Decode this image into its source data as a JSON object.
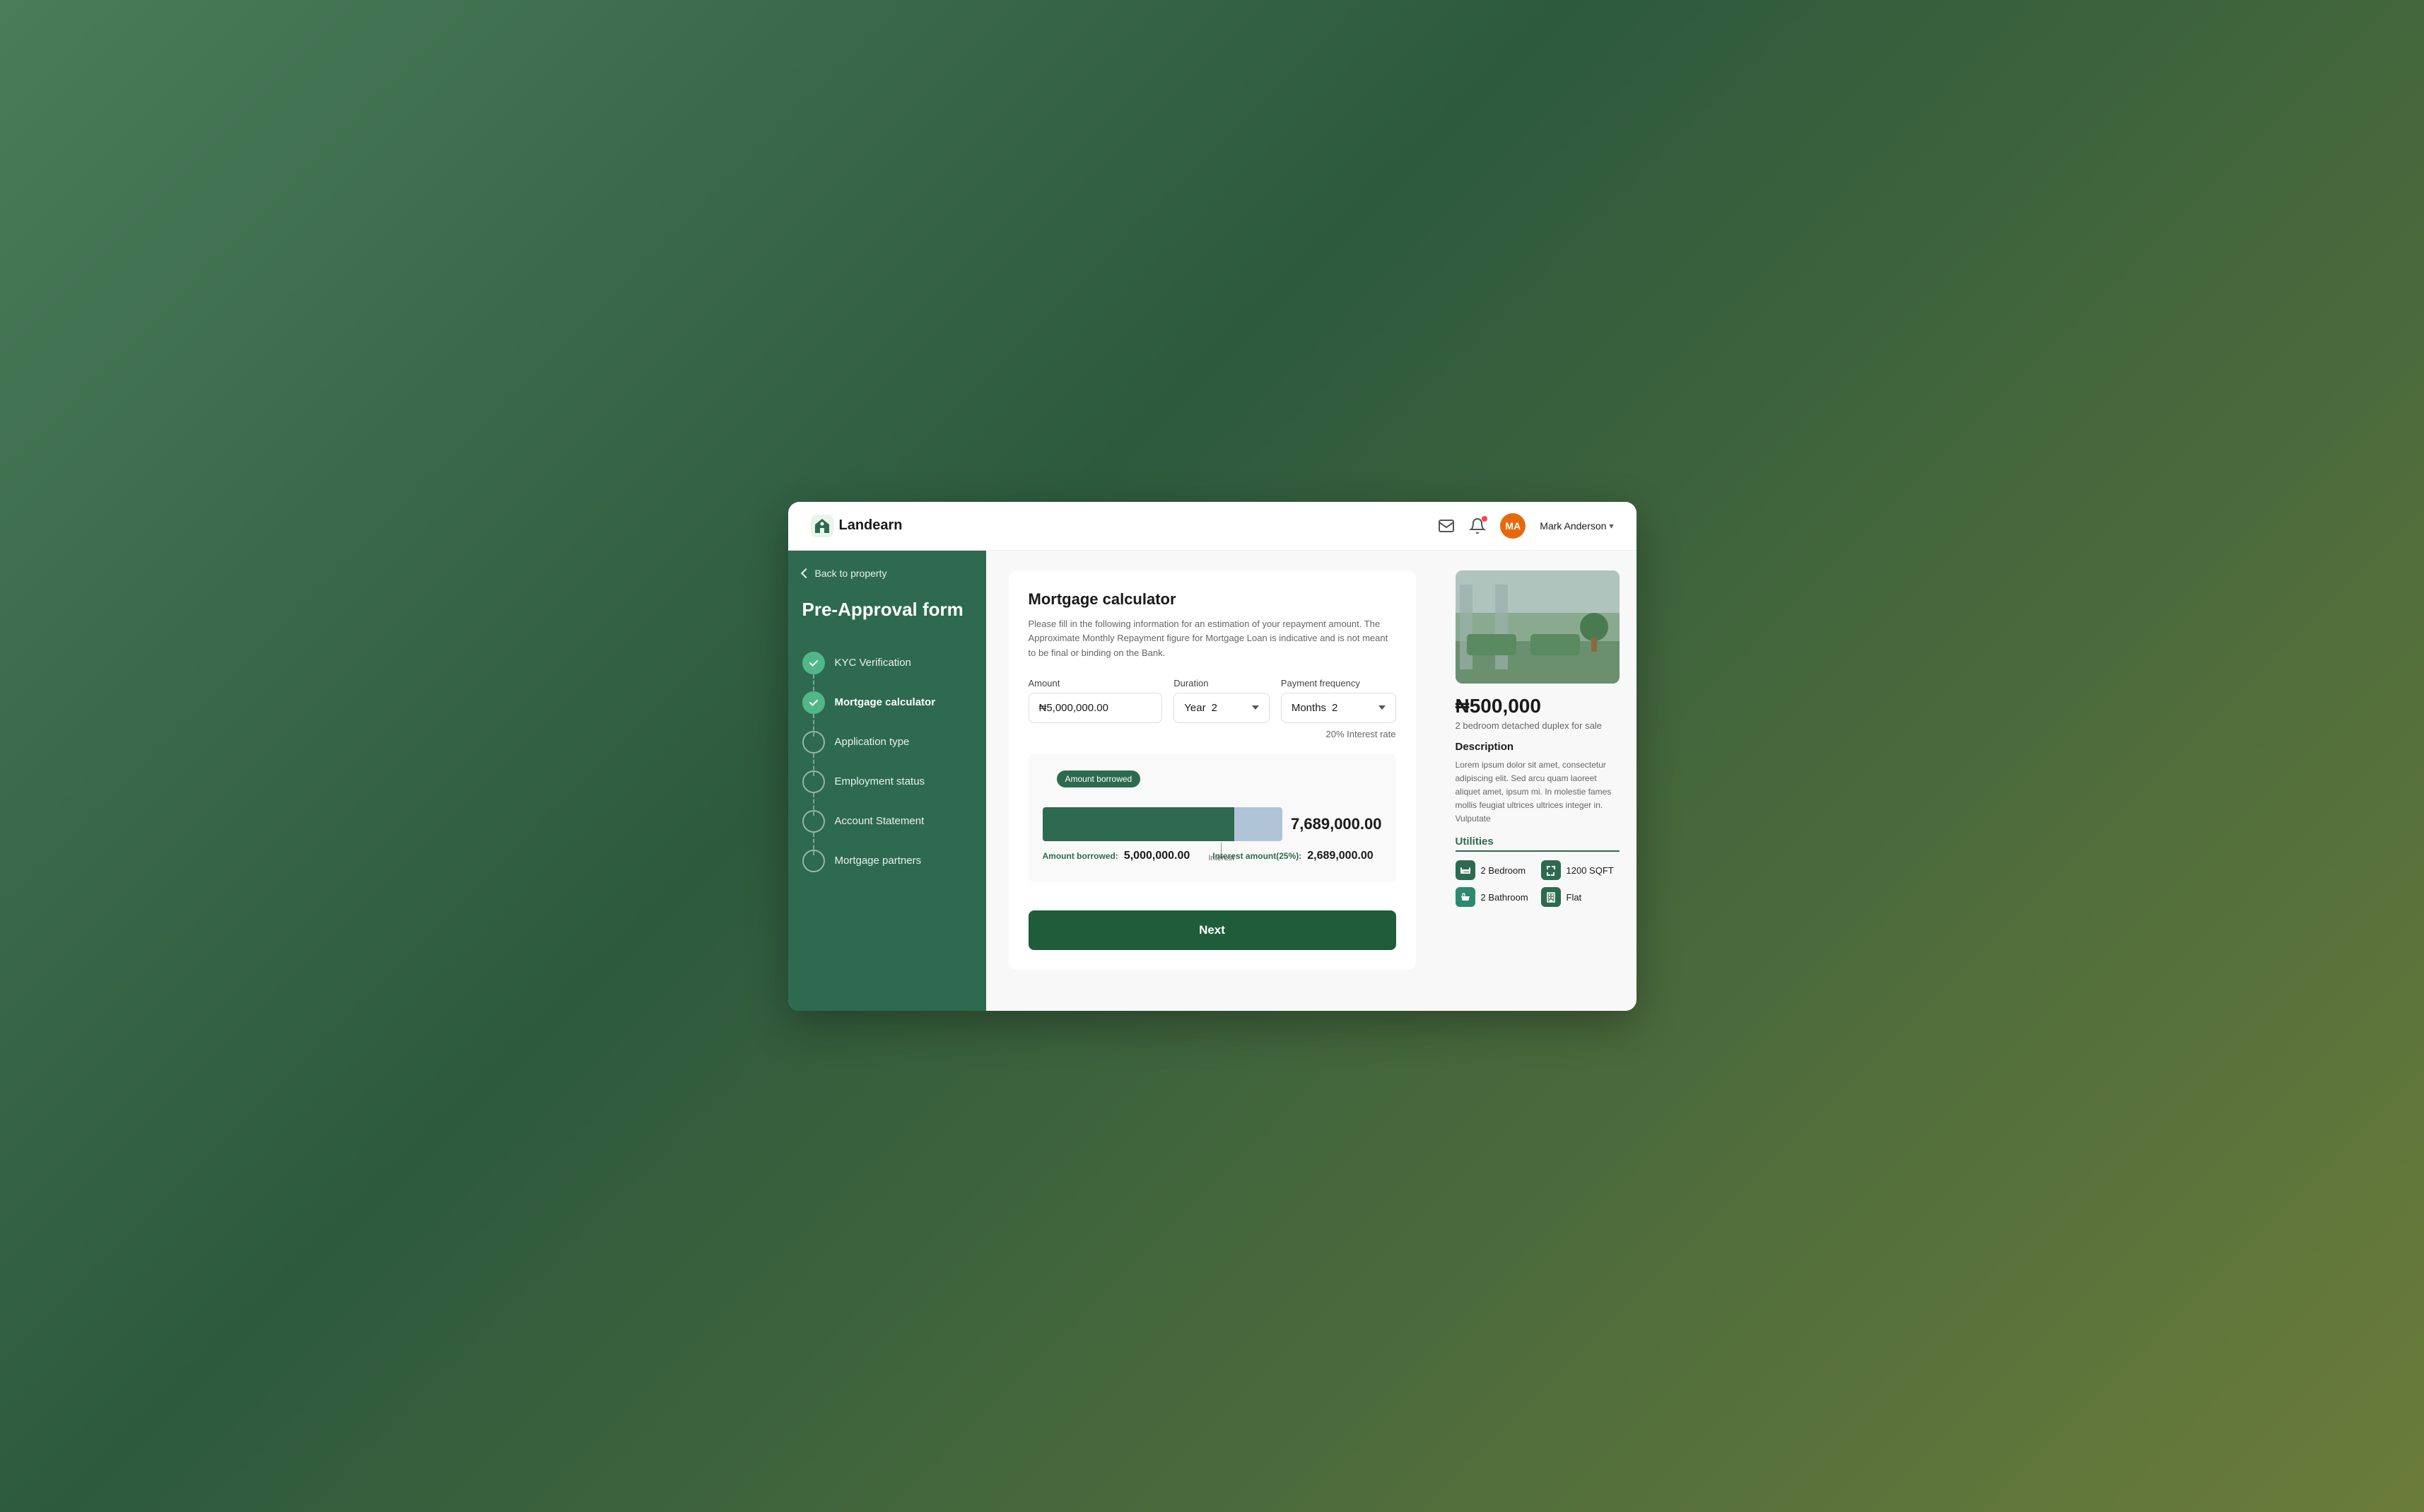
{
  "header": {
    "logo_text": "Landearn",
    "user_initials": "MA",
    "user_name": "Mark Anderson",
    "user_chevron": "▾"
  },
  "sidebar": {
    "back_label": "Back to property",
    "form_title": "Pre-Approval form",
    "steps": [
      {
        "id": "kyc",
        "label": "KYC Verification",
        "state": "completed"
      },
      {
        "id": "mortgage",
        "label": "Mortgage calculator",
        "state": "active"
      },
      {
        "id": "application",
        "label": "Application type",
        "state": "inactive"
      },
      {
        "id": "employment",
        "label": "Employment status",
        "state": "inactive"
      },
      {
        "id": "account",
        "label": "Account Statement",
        "state": "inactive"
      },
      {
        "id": "partners",
        "label": "Mortgage partners",
        "state": "inactive"
      }
    ]
  },
  "calculator": {
    "title": "Mortgage calculator",
    "description": "Please fill in the following information for an estimation of your repayment amount. The Approximate Monthly Repayment figure for Mortgage Loan is indicative and is not meant to be final or binding on the Bank.",
    "amount_label": "Amount",
    "amount_value": "₦5,000,000.00",
    "duration_label": "Duration",
    "duration_unit": "Year",
    "duration_value": "2",
    "frequency_label": "Payment frequency",
    "frequency_unit": "Months",
    "frequency_value": "2",
    "interest_rate_text": "20% Interest rate",
    "chart_tooltip": "Amount borrowed",
    "chart_total": "7,689,000.00",
    "interest_marker": "Interest",
    "amount_borrowed_label": "Amount borrowed:",
    "amount_borrowed_value": "5,000,000.00",
    "interest_amount_label": "Interest amount(25%):",
    "interest_amount_value": "2,689,000.00",
    "next_button": "Next"
  },
  "property": {
    "price": "₦500,000",
    "short_desc": "2 bedroom detached duplex for sale",
    "description_title": "Description",
    "description_text": "Lorem ipsum dolor sit amet, consectetur adipiscing elit. Sed arcu quam laoreet aliquet amet, ipsum mi. In molestie fames mollis feugiat ultrices ultrices integer in. Vulputate",
    "utilities_title": "Utilities",
    "utilities": [
      {
        "label": "2 Bedroom",
        "icon": "bed-icon",
        "icon_type": "green"
      },
      {
        "label": "1200 SQFT",
        "icon": "sqft-icon",
        "icon_type": "green-check"
      },
      {
        "label": "2 Bathroom",
        "icon": "bath-icon",
        "icon_type": "teal"
      },
      {
        "label": "Flat",
        "icon": "building-icon",
        "icon_type": "green"
      }
    ]
  }
}
